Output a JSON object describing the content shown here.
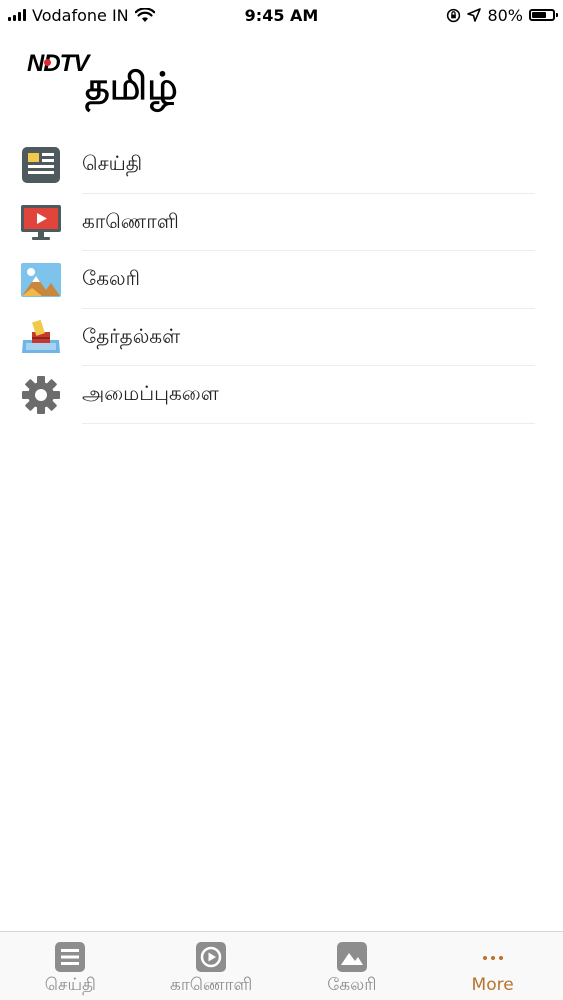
{
  "status_bar": {
    "carrier": "Vodafone IN",
    "time": "9:45 AM",
    "battery_percent": "80%",
    "battery_level": 0.8
  },
  "logo": {
    "brand": "NDTV",
    "tamil": "தமிழ்"
  },
  "menu": {
    "items": [
      {
        "label": "செய்தி",
        "icon": "news-icon"
      },
      {
        "label": "காணொளி",
        "icon": "video-icon"
      },
      {
        "label": "கேலரி",
        "icon": "gallery-icon"
      },
      {
        "label": "தேர்தல்கள்",
        "icon": "election-icon"
      },
      {
        "label": "அமைப்புகளை",
        "icon": "settings-gear-icon"
      }
    ]
  },
  "tabs": {
    "items": [
      {
        "label": "செய்தி",
        "icon": "news-icon",
        "active": false
      },
      {
        "label": "காணொளி",
        "icon": "play-icon",
        "active": false
      },
      {
        "label": "கேலரி",
        "icon": "image-icon",
        "active": false
      },
      {
        "label": "More",
        "icon": "more-dots-icon",
        "active": true
      }
    ]
  },
  "colors": {
    "accent": "#b8732e",
    "tab_inactive": "#8d8d8d",
    "icon_gray": "#6c6c6c",
    "news_icon_bg": "#4f5a5f",
    "video_red": "#e0443a",
    "ndtv_red": "#e4262d"
  }
}
